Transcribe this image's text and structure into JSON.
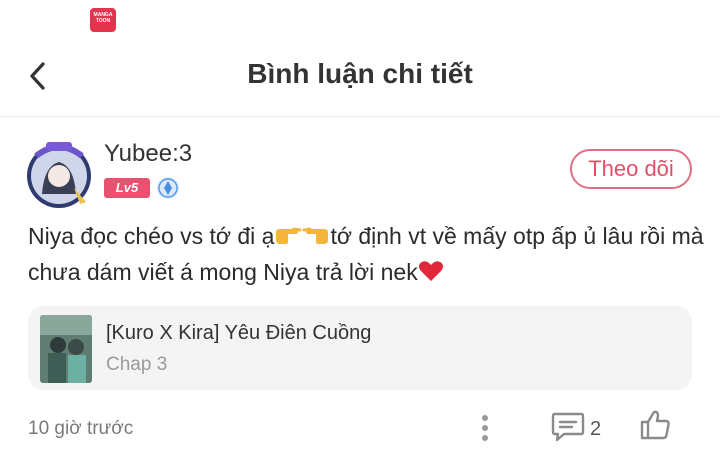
{
  "status_bar": {
    "app_logo_text": "MANGA TOON"
  },
  "header": {
    "title": "Bình luận chi tiết"
  },
  "comment": {
    "username": "Yubee:3",
    "level_badge": "Lv5",
    "follow_label": "Theo dõi",
    "text_part1": "Niya đọc chéo vs tớ đi ạ",
    "text_part2": "tớ định vt về mấy otp ấp ủ lâu rồi mà chưa dám viết á mong Niya trả lời nek",
    "emojis": [
      "pointing-right-icon",
      "pointing-left-icon",
      "heart-icon"
    ]
  },
  "story": {
    "title": "[Kuro X Kira] Yêu Điên Cuồng",
    "chapter": "Chap 3"
  },
  "footer": {
    "timestamp": "10 giờ trước",
    "reply_count": "2"
  },
  "colors": {
    "accent": "#e05068",
    "badge": "#e85271",
    "heart": "#e0283a",
    "card_bg": "#f4f4f4"
  }
}
